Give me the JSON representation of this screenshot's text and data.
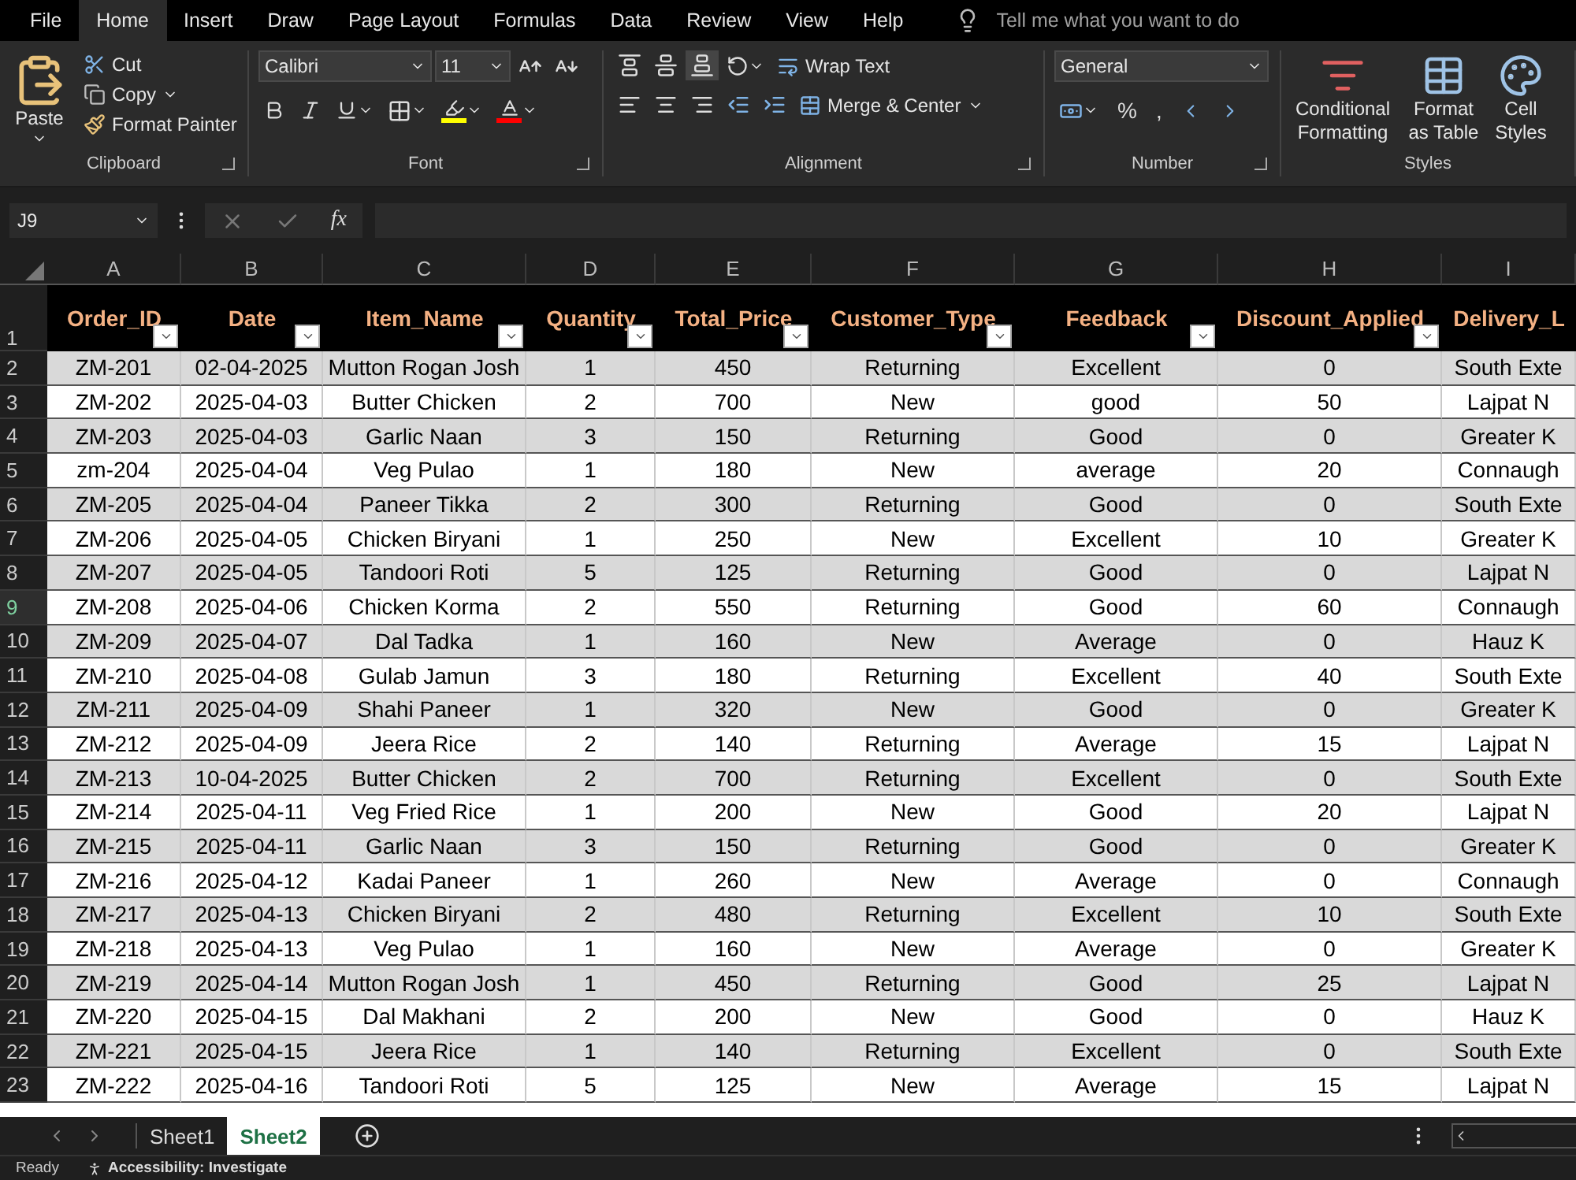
{
  "menu_tabs": [
    {
      "label": "File",
      "selected": false
    },
    {
      "label": "Home",
      "selected": true
    },
    {
      "label": "Insert",
      "selected": false
    },
    {
      "label": "Draw",
      "selected": false
    },
    {
      "label": "Page Layout",
      "selected": false
    },
    {
      "label": "Formulas",
      "selected": false
    },
    {
      "label": "Data",
      "selected": false
    },
    {
      "label": "Review",
      "selected": false
    },
    {
      "label": "View",
      "selected": false
    },
    {
      "label": "Help",
      "selected": false
    }
  ],
  "search": {
    "placeholder": "Tell me what you want to do"
  },
  "ribbon": {
    "clipboard": {
      "label": "Clipboard",
      "paste": "Paste",
      "cut": "Cut",
      "copy": "Copy",
      "format_painter": "Format Painter"
    },
    "font": {
      "label": "Font",
      "family": "Calibri",
      "size": "11"
    },
    "alignment": {
      "label": "Alignment",
      "wrap_text": "Wrap Text",
      "merge_center": "Merge & Center"
    },
    "number": {
      "label": "Number",
      "format": "General",
      "percent": "%",
      "comma": ","
    },
    "styles": {
      "label": "Styles",
      "buttons": [
        "Conditional Formatting",
        "Format as Table",
        "Cell Styles"
      ]
    }
  },
  "formula_bar": {
    "name_box": "J9",
    "function_label": "fx"
  },
  "sheet": {
    "columns": [
      "A",
      "B",
      "C",
      "D",
      "E",
      "F",
      "G",
      "H",
      "I"
    ],
    "header_row": {
      "number": "1",
      "cells": [
        "Order_ID",
        "Date",
        "Item_Name",
        "Quantity",
        "Total_Price",
        "Customer_Type",
        "Feedback",
        "Discount_Applied",
        "Delivery_L"
      ]
    },
    "rows": [
      {
        "number": "2",
        "selected": false,
        "cells": [
          "ZM-201",
          "02-04-2025",
          "Mutton Rogan Josh",
          "1",
          "450",
          "Returning",
          "Excellent",
          "0",
          "South Exte"
        ]
      },
      {
        "number": "3",
        "selected": false,
        "cells": [
          "ZM-202",
          "2025-04-03",
          "Butter Chicken",
          "2",
          "700",
          "New",
          "good",
          "50",
          "Lajpat N"
        ]
      },
      {
        "number": "4",
        "selected": false,
        "cells": [
          "ZM-203",
          "2025-04-03",
          "Garlic Naan",
          "3",
          "150",
          "Returning",
          "Good",
          "0",
          "Greater K"
        ]
      },
      {
        "number": "5",
        "selected": false,
        "cells": [
          "zm-204",
          "2025-04-04",
          "Veg Pulao",
          "1",
          "180",
          "New",
          "average",
          "20",
          "Connaugh"
        ]
      },
      {
        "number": "6",
        "selected": false,
        "cells": [
          "ZM-205",
          "2025-04-04",
          "Paneer Tikka",
          "2",
          "300",
          "Returning",
          "Good",
          "0",
          "South Exte"
        ]
      },
      {
        "number": "7",
        "selected": false,
        "cells": [
          "ZM-206",
          "2025-04-05",
          "Chicken Biryani",
          "1",
          "250",
          "New",
          "Excellent",
          "10",
          "Greater K"
        ]
      },
      {
        "number": "8",
        "selected": false,
        "cells": [
          "ZM-207",
          "2025-04-05",
          "Tandoori Roti",
          "5",
          "125",
          "Returning",
          "Good",
          "0",
          "Lajpat N"
        ]
      },
      {
        "number": "9",
        "selected": true,
        "cells": [
          "ZM-208",
          "2025-04-06",
          "Chicken Korma",
          "2",
          "550",
          "Returning",
          "Good",
          "60",
          "Connaugh"
        ]
      },
      {
        "number": "10",
        "selected": false,
        "cells": [
          "ZM-209",
          "2025-04-07",
          "Dal Tadka",
          "1",
          "160",
          "New",
          "Average",
          "0",
          "Hauz K"
        ]
      },
      {
        "number": "11",
        "selected": false,
        "cells": [
          "ZM-210",
          "2025-04-08",
          "Gulab Jamun",
          "3",
          "180",
          "Returning",
          "Excellent",
          "40",
          "South Exte"
        ]
      },
      {
        "number": "12",
        "selected": false,
        "cells": [
          "ZM-211",
          "2025-04-09",
          "Shahi Paneer",
          "1",
          "320",
          "New",
          "Good",
          "0",
          "Greater K"
        ]
      },
      {
        "number": "13",
        "selected": false,
        "cells": [
          "ZM-212",
          "2025-04-09",
          "Jeera Rice",
          "2",
          "140",
          "Returning",
          "Average",
          "15",
          "Lajpat N"
        ]
      },
      {
        "number": "14",
        "selected": false,
        "cells": [
          "ZM-213",
          "10-04-2025",
          "Butter Chicken",
          "2",
          "700",
          "Returning",
          "Excellent",
          "0",
          "South Exte"
        ]
      },
      {
        "number": "15",
        "selected": false,
        "cells": [
          "ZM-214",
          "2025-04-11",
          "Veg Fried Rice",
          "1",
          "200",
          "New",
          "Good",
          "20",
          "Lajpat N"
        ]
      },
      {
        "number": "16",
        "selected": false,
        "cells": [
          "ZM-215",
          "2025-04-11",
          "Garlic Naan",
          "3",
          "150",
          "Returning",
          "Good",
          "0",
          "Greater K"
        ]
      },
      {
        "number": "17",
        "selected": false,
        "cells": [
          "ZM-216",
          "2025-04-12",
          "Kadai Paneer",
          "1",
          "260",
          "New",
          "Average",
          "0",
          "Connaugh"
        ]
      },
      {
        "number": "18",
        "selected": false,
        "cells": [
          "ZM-217",
          "2025-04-13",
          "Chicken Biryani",
          "2",
          "480",
          "Returning",
          "Excellent",
          "10",
          "South Exte"
        ]
      },
      {
        "number": "19",
        "selected": false,
        "cells": [
          "ZM-218",
          "2025-04-13",
          "Veg Pulao",
          "1",
          "160",
          "New",
          "Average",
          "0",
          "Greater K"
        ]
      },
      {
        "number": "20",
        "selected": false,
        "cells": [
          "ZM-219",
          "2025-04-14",
          "Mutton Rogan Josh",
          "1",
          "450",
          "Returning",
          "Good",
          "25",
          "Lajpat N"
        ]
      },
      {
        "number": "21",
        "selected": false,
        "cells": [
          "ZM-220",
          "2025-04-15",
          "Dal Makhani",
          "2",
          "200",
          "New",
          "Good",
          "0",
          "Hauz K"
        ]
      },
      {
        "number": "22",
        "selected": false,
        "cells": [
          "ZM-221",
          "2025-04-15",
          "Jeera Rice",
          "1",
          "140",
          "Returning",
          "Excellent",
          "0",
          "South Exte"
        ]
      },
      {
        "number": "23",
        "selected": false,
        "cells": [
          "ZM-222",
          "2025-04-16",
          "Tandoori Roti",
          "5",
          "125",
          "New",
          "Average",
          "15",
          "Lajpat N"
        ]
      }
    ]
  },
  "sheet_tabs": [
    {
      "label": "Sheet1",
      "selected": false
    },
    {
      "label": "Sheet2",
      "selected": true
    }
  ],
  "status_bar": {
    "status": "Ready",
    "accessibility": "Accessibility: Investigate"
  }
}
